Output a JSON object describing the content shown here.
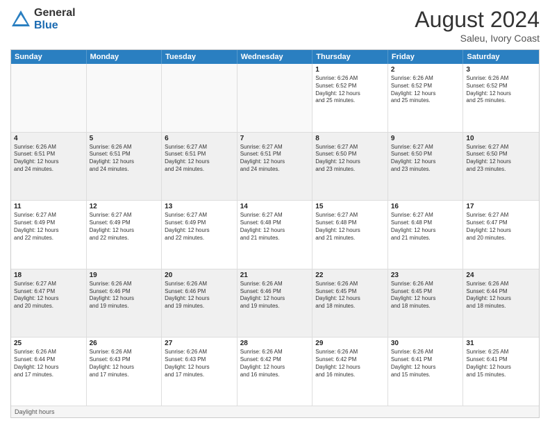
{
  "logo": {
    "general": "General",
    "blue": "Blue"
  },
  "title": {
    "month_year": "August 2024",
    "location": "Saleu, Ivory Coast"
  },
  "calendar": {
    "headers": [
      "Sunday",
      "Monday",
      "Tuesday",
      "Wednesday",
      "Thursday",
      "Friday",
      "Saturday"
    ],
    "footer": "Daylight hours"
  },
  "weeks": [
    {
      "days": [
        {
          "num": "",
          "text": "",
          "empty": true
        },
        {
          "num": "",
          "text": "",
          "empty": true
        },
        {
          "num": "",
          "text": "",
          "empty": true
        },
        {
          "num": "",
          "text": "",
          "empty": true
        },
        {
          "num": "1",
          "text": "Sunrise: 6:26 AM\nSunset: 6:52 PM\nDaylight: 12 hours\nand 25 minutes.",
          "empty": false
        },
        {
          "num": "2",
          "text": "Sunrise: 6:26 AM\nSunset: 6:52 PM\nDaylight: 12 hours\nand 25 minutes.",
          "empty": false
        },
        {
          "num": "3",
          "text": "Sunrise: 6:26 AM\nSunset: 6:52 PM\nDaylight: 12 hours\nand 25 minutes.",
          "empty": false
        }
      ]
    },
    {
      "days": [
        {
          "num": "4",
          "text": "Sunrise: 6:26 AM\nSunset: 6:51 PM\nDaylight: 12 hours\nand 24 minutes.",
          "empty": false
        },
        {
          "num": "5",
          "text": "Sunrise: 6:26 AM\nSunset: 6:51 PM\nDaylight: 12 hours\nand 24 minutes.",
          "empty": false
        },
        {
          "num": "6",
          "text": "Sunrise: 6:27 AM\nSunset: 6:51 PM\nDaylight: 12 hours\nand 24 minutes.",
          "empty": false
        },
        {
          "num": "7",
          "text": "Sunrise: 6:27 AM\nSunset: 6:51 PM\nDaylight: 12 hours\nand 24 minutes.",
          "empty": false
        },
        {
          "num": "8",
          "text": "Sunrise: 6:27 AM\nSunset: 6:50 PM\nDaylight: 12 hours\nand 23 minutes.",
          "empty": false
        },
        {
          "num": "9",
          "text": "Sunrise: 6:27 AM\nSunset: 6:50 PM\nDaylight: 12 hours\nand 23 minutes.",
          "empty": false
        },
        {
          "num": "10",
          "text": "Sunrise: 6:27 AM\nSunset: 6:50 PM\nDaylight: 12 hours\nand 23 minutes.",
          "empty": false
        }
      ]
    },
    {
      "days": [
        {
          "num": "11",
          "text": "Sunrise: 6:27 AM\nSunset: 6:49 PM\nDaylight: 12 hours\nand 22 minutes.",
          "empty": false
        },
        {
          "num": "12",
          "text": "Sunrise: 6:27 AM\nSunset: 6:49 PM\nDaylight: 12 hours\nand 22 minutes.",
          "empty": false
        },
        {
          "num": "13",
          "text": "Sunrise: 6:27 AM\nSunset: 6:49 PM\nDaylight: 12 hours\nand 22 minutes.",
          "empty": false
        },
        {
          "num": "14",
          "text": "Sunrise: 6:27 AM\nSunset: 6:48 PM\nDaylight: 12 hours\nand 21 minutes.",
          "empty": false
        },
        {
          "num": "15",
          "text": "Sunrise: 6:27 AM\nSunset: 6:48 PM\nDaylight: 12 hours\nand 21 minutes.",
          "empty": false
        },
        {
          "num": "16",
          "text": "Sunrise: 6:27 AM\nSunset: 6:48 PM\nDaylight: 12 hours\nand 21 minutes.",
          "empty": false
        },
        {
          "num": "17",
          "text": "Sunrise: 6:27 AM\nSunset: 6:47 PM\nDaylight: 12 hours\nand 20 minutes.",
          "empty": false
        }
      ]
    },
    {
      "days": [
        {
          "num": "18",
          "text": "Sunrise: 6:27 AM\nSunset: 6:47 PM\nDaylight: 12 hours\nand 20 minutes.",
          "empty": false
        },
        {
          "num": "19",
          "text": "Sunrise: 6:26 AM\nSunset: 6:46 PM\nDaylight: 12 hours\nand 19 minutes.",
          "empty": false
        },
        {
          "num": "20",
          "text": "Sunrise: 6:26 AM\nSunset: 6:46 PM\nDaylight: 12 hours\nand 19 minutes.",
          "empty": false
        },
        {
          "num": "21",
          "text": "Sunrise: 6:26 AM\nSunset: 6:46 PM\nDaylight: 12 hours\nand 19 minutes.",
          "empty": false
        },
        {
          "num": "22",
          "text": "Sunrise: 6:26 AM\nSunset: 6:45 PM\nDaylight: 12 hours\nand 18 minutes.",
          "empty": false
        },
        {
          "num": "23",
          "text": "Sunrise: 6:26 AM\nSunset: 6:45 PM\nDaylight: 12 hours\nand 18 minutes.",
          "empty": false
        },
        {
          "num": "24",
          "text": "Sunrise: 6:26 AM\nSunset: 6:44 PM\nDaylight: 12 hours\nand 18 minutes.",
          "empty": false
        }
      ]
    },
    {
      "days": [
        {
          "num": "25",
          "text": "Sunrise: 6:26 AM\nSunset: 6:44 PM\nDaylight: 12 hours\nand 17 minutes.",
          "empty": false
        },
        {
          "num": "26",
          "text": "Sunrise: 6:26 AM\nSunset: 6:43 PM\nDaylight: 12 hours\nand 17 minutes.",
          "empty": false
        },
        {
          "num": "27",
          "text": "Sunrise: 6:26 AM\nSunset: 6:43 PM\nDaylight: 12 hours\nand 17 minutes.",
          "empty": false
        },
        {
          "num": "28",
          "text": "Sunrise: 6:26 AM\nSunset: 6:42 PM\nDaylight: 12 hours\nand 16 minutes.",
          "empty": false
        },
        {
          "num": "29",
          "text": "Sunrise: 6:26 AM\nSunset: 6:42 PM\nDaylight: 12 hours\nand 16 minutes.",
          "empty": false
        },
        {
          "num": "30",
          "text": "Sunrise: 6:26 AM\nSunset: 6:41 PM\nDaylight: 12 hours\nand 15 minutes.",
          "empty": false
        },
        {
          "num": "31",
          "text": "Sunrise: 6:25 AM\nSunset: 6:41 PM\nDaylight: 12 hours\nand 15 minutes.",
          "empty": false
        }
      ]
    }
  ]
}
